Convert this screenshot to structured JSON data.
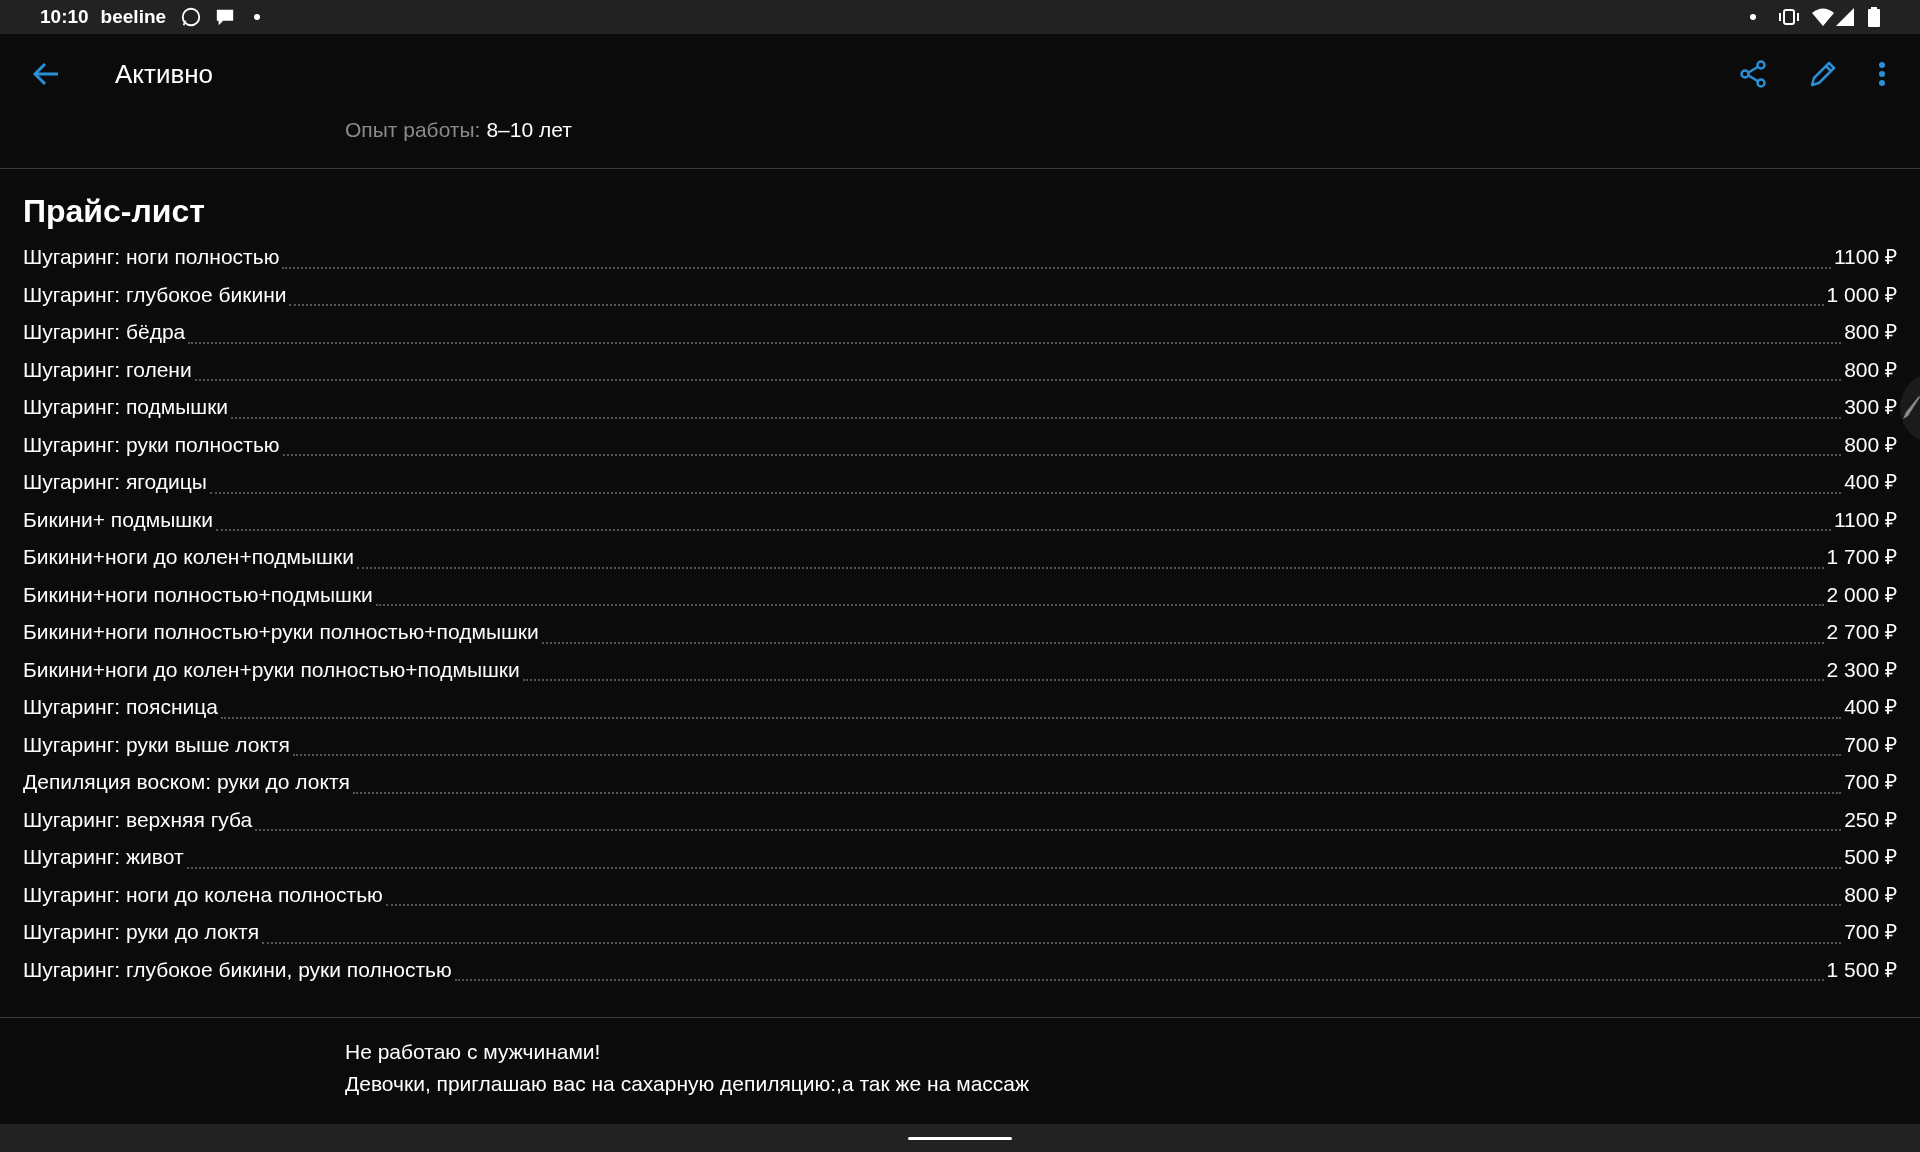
{
  "status_bar": {
    "time": "10:10",
    "carrier": "beeline"
  },
  "header": {
    "title": "Активно"
  },
  "experience": {
    "label": "Опыт работы:",
    "value": "8–10 лет"
  },
  "price_list": {
    "title": "Прайс-лист",
    "items": [
      {
        "name": "Шугаринг: ноги полностью",
        "price": "1100 ₽"
      },
      {
        "name": "Шугаринг: глубокое бикини",
        "price": "1 000 ₽"
      },
      {
        "name": "Шугаринг: бёдра",
        "price": "800 ₽"
      },
      {
        "name": "Шугаринг: голени",
        "price": "800 ₽"
      },
      {
        "name": "Шугаринг: подмышки",
        "price": "300 ₽"
      },
      {
        "name": "Шугаринг: руки полностью",
        "price": "800 ₽"
      },
      {
        "name": "Шугаринг: ягодицы",
        "price": "400 ₽"
      },
      {
        "name": "Бикини+ подмышки",
        "price": "1100 ₽"
      },
      {
        "name": "Бикини+ноги до колен+подмышки",
        "price": "1 700 ₽"
      },
      {
        "name": "Бикини+ноги полностью+подмышки",
        "price": "2 000 ₽"
      },
      {
        "name": "Бикини+ноги полностью+руки полностью+подмышки",
        "price": "2 700 ₽"
      },
      {
        "name": "Бикини+ноги до колен+руки полностью+подмышки",
        "price": "2 300 ₽"
      },
      {
        "name": "Шугаринг: поясница",
        "price": "400 ₽"
      },
      {
        "name": "Шугаринг: руки выше локтя",
        "price": "700 ₽"
      },
      {
        "name": "Депиляция воском: руки до локтя",
        "price": "700 ₽"
      },
      {
        "name": "Шугаринг: верхняя губа",
        "price": "250 ₽"
      },
      {
        "name": "Шугаринг: живот",
        "price": "500 ₽"
      },
      {
        "name": "Шугаринг: ноги до колена полностью",
        "price": "800 ₽"
      },
      {
        "name": "Шугаринг: руки до локтя",
        "price": "700 ₽"
      },
      {
        "name": "Шугаринг: глубокое бикини, руки полностью",
        "price": "1 500 ₽"
      }
    ]
  },
  "description": [
    "Не работаю с мужчинами!",
    "Девочки, приглашаю вас на сахарную депиляцию:,а так же на массаж"
  ]
}
